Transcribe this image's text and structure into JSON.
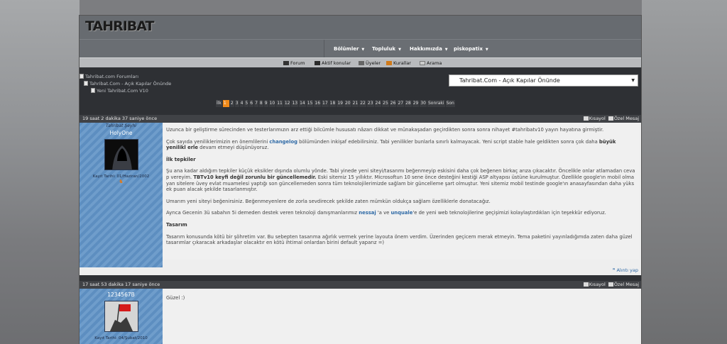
{
  "logo": "TAHRIBAT",
  "topnav": [
    {
      "label": "Bölümler"
    },
    {
      "label": "Topluluk"
    },
    {
      "label": "Hakkımızda"
    },
    {
      "label": "piskopatix"
    }
  ],
  "subnav": [
    {
      "label": "Forum",
      "icon": "forum-icon"
    },
    {
      "label": "Aktif konular",
      "icon": "active-topics-icon"
    },
    {
      "label": "Üyeler",
      "icon": "members-icon"
    },
    {
      "label": "Kurallar",
      "icon": "rules-icon"
    },
    {
      "label": "Arama",
      "icon": "search-icon"
    }
  ],
  "breadcrumb": [
    "Tahribat.com Forumları",
    "Tahribat.Com - Açık Kapılar Önünde",
    "Yeni Tahribat.Com V10"
  ],
  "forum_jump": {
    "selected": "Tahribat.Com - Açık Kapılar Önünde"
  },
  "pagination": {
    "first": "İlk",
    "current": "1",
    "pages": [
      "2",
      "3",
      "4",
      "5",
      "6",
      "7",
      "8",
      "9",
      "10",
      "11",
      "12",
      "13",
      "14",
      "15",
      "16",
      "17",
      "18",
      "19",
      "20",
      "21",
      "22",
      "23",
      "24",
      "25",
      "26",
      "27",
      "28",
      "29",
      "30"
    ],
    "next": "Sonraki",
    "last": "Son"
  },
  "actions": {
    "quote_short": "Kısayol",
    "private_msg": "Özel Mesaj",
    "reply_quote": "Alıntı yap"
  },
  "post1": {
    "time": "19 saat 2 dakika 37 saniye önce",
    "user_title": "Tahribat Şeyhi",
    "username": "HolyOne",
    "joined": "Kayıt Tarihi: 01/Haziran/2002",
    "p1": "Uzunca bir geliştirme sürecinden ve testerlarımızın arz ettiği bilcümle hususatı nâzarı dikkat ve münakaşadan geçirdikten sonra sonra nihayet #tahribatv10 yayın hayatına girmiştir.",
    "p2a": "Çok sayıda yeniliklerimizin en önemlilerini ",
    "p2link": "changelog",
    "p2b": " bölümünden inkişaf edebilirsiniz. Tabi yenilikler bunlarla sınırlı kalmayacak. Yeni script stable hale geldikten sonra çok daha ",
    "p2bold": "büyük yenilikl erle",
    "p2c": " devam etmeyi düşünüyoruz.",
    "h1": "İlk tepkiler",
    "p3a": "Şu ana kadar aldığım tepkiler küçük eksikler dışında olumlu yönde. Tabi yinede yeni siteyi/tasarımı beğenmeyip eskisini daha çok beğenen birkaç arıza çıkacaktır. Öncelikle onlar atlamadan ceva p vereyim. ",
    "p3bold": "TBTv10 keyfi değil zorunlu bir güncellemedir.",
    "p3b": " Eski sitemiz 15 yıllıktır. Microsoftun 10 sene önce desteğini kestiği ASP altyapısı üstüne kurulmuştur. Özellikle google'ın mobil olma yan sitelere üvey evlat muamelesi yaptığı son güncellemeden sonra tüm teknolojilerimizde sağlam bir güncelleme şart olmuştur. Yeni sitemiz mobil testinde google'ın anasayfasından daha yüks ek puan alacak şekilde tasarlanmıştır.",
    "p4": "Umarım yeni siteyi beğenirsiniz. Beğenmeyenlere de zorla sevdirecek şekilde zaten mümkün oldukça sağlam özelliklerle donatacağız.",
    "p5a": "Ayrıca Gecenin 3ü sabahın 5i demeden destek veren teknoloji danışmanlarımız ",
    "p5link1": "nessaj",
    "p5b": " 'a ve ",
    "p5link2": "unquale",
    "p5c": "'e de yeni web teknolojilerine geçişimizi kolaylaştırdıkları için teşekkür ediyoruz.",
    "h2": "Tasarım",
    "p6": "Tasarım konusunda kötü bir şöhretim var. Bu sebepten tasarıma ağırlık vermek yerine layouta önem verdim. Üzerinden geçicem merak etmeyin. Tema paketini yayınladığımda zaten daha güzel tasarımlar çıkaracak arkadaşlar olacaktır en kötü ihtimal onlardan birini default yaparız =)"
  },
  "post2": {
    "time": "17 saat 53 dakika 17 saniye önce",
    "username": "1234567B",
    "joined": "Kayıt Tarihi: 04/Şubat/2010",
    "text": "Güzel :)"
  }
}
